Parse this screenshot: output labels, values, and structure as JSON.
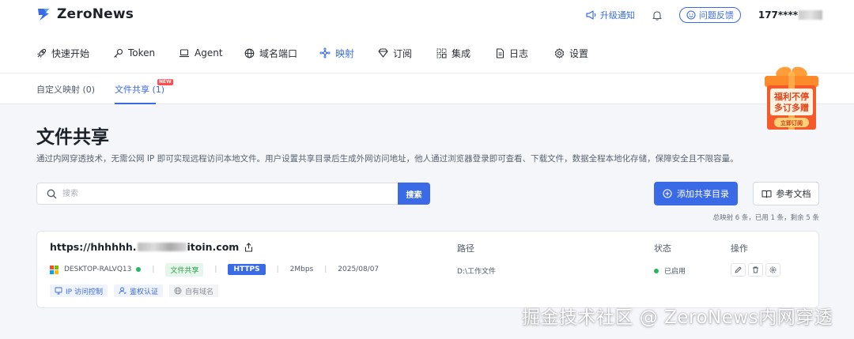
{
  "app": {
    "name": "ZeroNews"
  },
  "header": {
    "upgrade_label": "升级通知",
    "feedback_label": "问题反馈",
    "user_phone": "177****"
  },
  "nav": {
    "items": [
      {
        "label": "快速开始",
        "icon": "rocket-icon",
        "active": false
      },
      {
        "label": "Token",
        "icon": "key-icon",
        "active": false
      },
      {
        "label": "Agent",
        "icon": "laptop-icon",
        "active": false
      },
      {
        "label": "域名端口",
        "icon": "globe-icon",
        "active": false
      },
      {
        "label": "映射",
        "icon": "mapping-icon",
        "active": true
      },
      {
        "label": "订阅",
        "icon": "diamond-icon",
        "active": false
      },
      {
        "label": "集成",
        "icon": "integration-icon",
        "active": false
      },
      {
        "label": "日志",
        "icon": "document-icon",
        "active": false
      },
      {
        "label": "设置",
        "icon": "gear-icon",
        "active": false
      }
    ]
  },
  "subtabs": {
    "items": [
      {
        "label": "自定义映射 (0)",
        "active": false
      },
      {
        "label": "文件共享 (1)",
        "active": true
      }
    ],
    "new_badge": "NEW"
  },
  "promo": {
    "line1": "福利不停",
    "line2": "多订多赠",
    "cta": "立即订阅"
  },
  "page": {
    "title": "文件共享",
    "description": "通过内网穿透技术，无需公网 IP 即可实现远程访问本地文件。用户设置共享目录后生成外网访问地址，他人通过浏览器登录即可查看、下载文件，数据全程本地化存储，保障安全且不限容量。"
  },
  "search": {
    "placeholder": "搜索",
    "button_label": "搜索"
  },
  "actions": {
    "add_label": "添加共享目录",
    "doc_label": "参考文档"
  },
  "stats": "总映射 6 条，已用 1 条，剩余 5 条",
  "table": {
    "headers": {
      "path": "路径",
      "status": "状态",
      "ops": "操作"
    },
    "rows": [
      {
        "domain_prefix": "https://hhhhhh.",
        "domain_suffix": "itoin.com",
        "device": "DESKTOP-RALVQ13",
        "type_tag": "文件共享",
        "protocol": "HTTPS",
        "bandwidth": "2Mbps",
        "date": "2025/08/07",
        "path": "D:\\工作文件",
        "status": "已启用",
        "features": [
          {
            "label": "IP 访问控制",
            "icon": "shield-icon",
            "enabled": true
          },
          {
            "label": "鉴权认证",
            "icon": "user-icon",
            "enabled": true
          },
          {
            "label": "自有域名",
            "icon": "globe-icon",
            "enabled": false
          }
        ]
      }
    ]
  },
  "watermark": "掘金技术社区 @ ZeroNews内网穿透",
  "colors": {
    "accent": "#3a6ae6",
    "success": "#23b860",
    "danger": "#ff4d4f"
  }
}
